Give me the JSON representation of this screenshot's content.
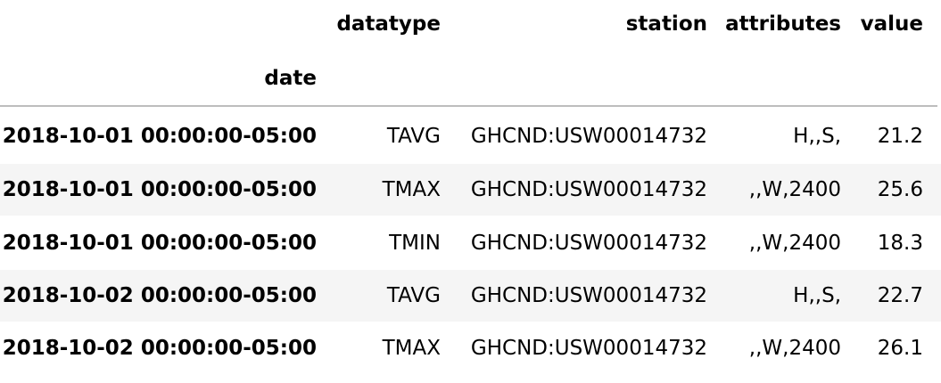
{
  "table": {
    "columns": [
      "datatype",
      "station",
      "attributes",
      "value"
    ],
    "index_name": "date",
    "rows": [
      {
        "date": "2018-10-01 00:00:00-05:00",
        "datatype": "TAVG",
        "station": "GHCND:USW00014732",
        "attributes": "H,,S,",
        "value": "21.2"
      },
      {
        "date": "2018-10-01 00:00:00-05:00",
        "datatype": "TMAX",
        "station": "GHCND:USW00014732",
        "attributes": ",,W,2400",
        "value": "25.6"
      },
      {
        "date": "2018-10-01 00:00:00-05:00",
        "datatype": "TMIN",
        "station": "GHCND:USW00014732",
        "attributes": ",,W,2400",
        "value": "18.3"
      },
      {
        "date": "2018-10-02 00:00:00-05:00",
        "datatype": "TAVG",
        "station": "GHCND:USW00014732",
        "attributes": "H,,S,",
        "value": "22.7"
      },
      {
        "date": "2018-10-02 00:00:00-05:00",
        "datatype": "TMAX",
        "station": "GHCND:USW00014732",
        "attributes": ",,W,2400",
        "value": "26.1"
      }
    ]
  },
  "colors": {
    "striped_row_background": "#f5f5f5",
    "header_rule": "#bdbdbd",
    "text": "#000000"
  }
}
